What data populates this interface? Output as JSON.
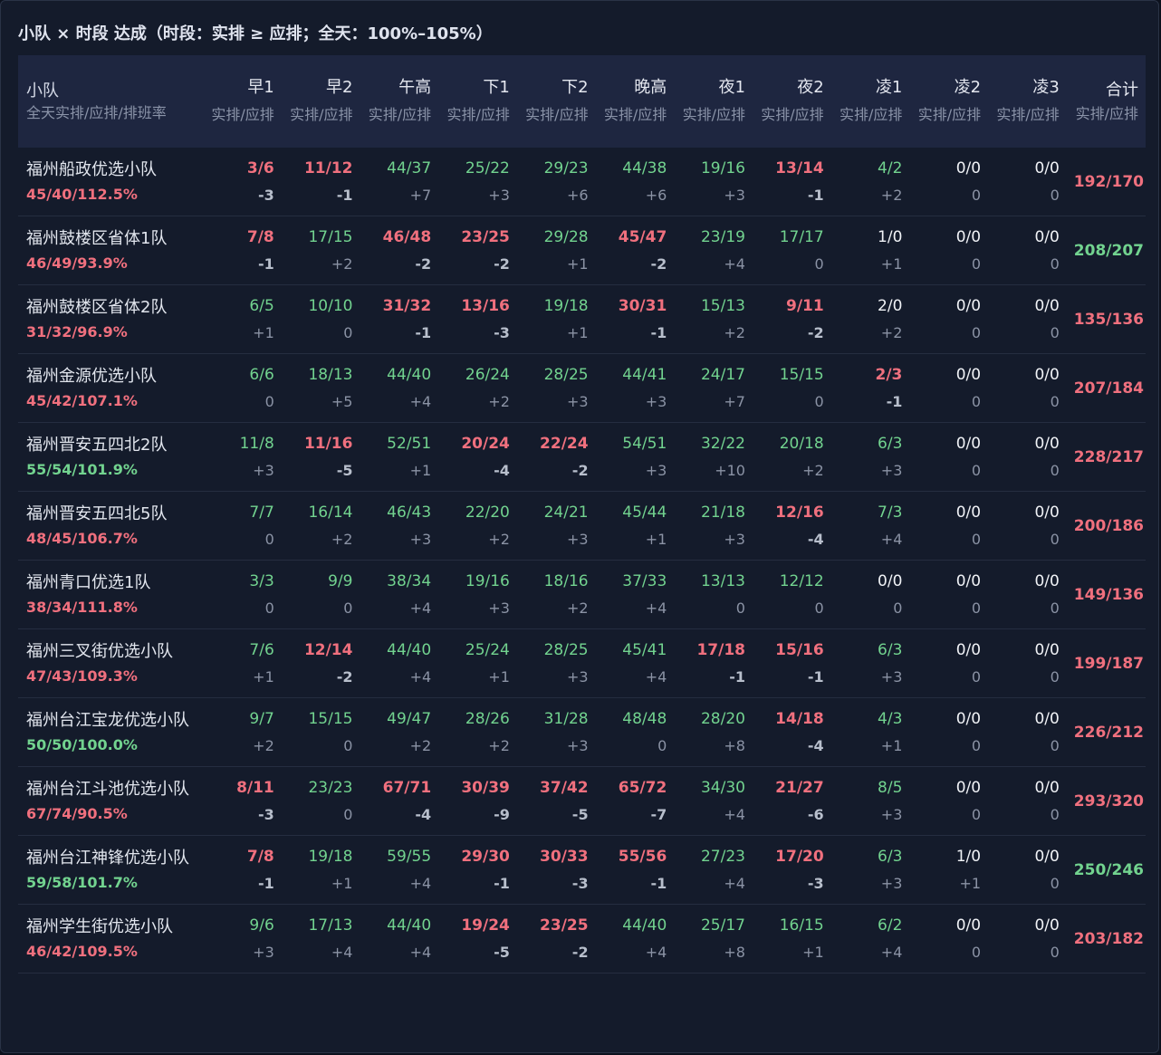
{
  "title": "小队 × 时段 达成（时段：实排 ≥ 应排；全天：100%–105%）",
  "colors": {
    "below": "#f0707e",
    "ok": "#72d38f",
    "zero": "#f0f2f6"
  },
  "header": {
    "team_title": "小队",
    "team_sub": "全天实排/应排/排班率",
    "slots": [
      {
        "name": "早1",
        "sub": "实排/应排"
      },
      {
        "name": "早2",
        "sub": "实排/应排"
      },
      {
        "name": "午高",
        "sub": "实排/应排"
      },
      {
        "name": "下1",
        "sub": "实排/应排"
      },
      {
        "name": "下2",
        "sub": "实排/应排"
      },
      {
        "name": "晚高",
        "sub": "实排/应排"
      },
      {
        "name": "夜1",
        "sub": "实排/应排"
      },
      {
        "name": "夜2",
        "sub": "实排/应排"
      },
      {
        "name": "凌1",
        "sub": "实排/应排"
      },
      {
        "name": "凌2",
        "sub": "实排/应排"
      },
      {
        "name": "凌3",
        "sub": "实排/应排"
      }
    ],
    "total_name": "合计",
    "total_sub": "实排/应排"
  },
  "rows": [
    {
      "team": "福州船政优选小队",
      "summary": "45/40/112.5%",
      "summary_status": "red",
      "cells": [
        [
          "3/6",
          "-3",
          "red"
        ],
        [
          "11/12",
          "-1",
          "red"
        ],
        [
          "44/37",
          "+7",
          "green"
        ],
        [
          "25/22",
          "+3",
          "green"
        ],
        [
          "29/23",
          "+6",
          "green"
        ],
        [
          "44/38",
          "+6",
          "green"
        ],
        [
          "19/16",
          "+3",
          "green"
        ],
        [
          "13/14",
          "-1",
          "red"
        ],
        [
          "4/2",
          "+2",
          "green"
        ],
        [
          "0/0",
          "0",
          "white"
        ],
        [
          "0/0",
          "0",
          "white"
        ]
      ],
      "total": "192/170",
      "total_status": "red"
    },
    {
      "team": "福州鼓楼区省体1队",
      "summary": "46/49/93.9%",
      "summary_status": "red",
      "cells": [
        [
          "7/8",
          "-1",
          "red"
        ],
        [
          "17/15",
          "+2",
          "green"
        ],
        [
          "46/48",
          "-2",
          "red"
        ],
        [
          "23/25",
          "-2",
          "red"
        ],
        [
          "29/28",
          "+1",
          "green"
        ],
        [
          "45/47",
          "-2",
          "red"
        ],
        [
          "23/19",
          "+4",
          "green"
        ],
        [
          "17/17",
          "0",
          "green"
        ],
        [
          "1/0",
          "+1",
          "white"
        ],
        [
          "0/0",
          "0",
          "white"
        ],
        [
          "0/0",
          "0",
          "white"
        ]
      ],
      "total": "208/207",
      "total_status": "green"
    },
    {
      "team": "福州鼓楼区省体2队",
      "summary": "31/32/96.9%",
      "summary_status": "red",
      "cells": [
        [
          "6/5",
          "+1",
          "green"
        ],
        [
          "10/10",
          "0",
          "green"
        ],
        [
          "31/32",
          "-1",
          "red"
        ],
        [
          "13/16",
          "-3",
          "red"
        ],
        [
          "19/18",
          "+1",
          "green"
        ],
        [
          "30/31",
          "-1",
          "red"
        ],
        [
          "15/13",
          "+2",
          "green"
        ],
        [
          "9/11",
          "-2",
          "red"
        ],
        [
          "2/0",
          "+2",
          "white"
        ],
        [
          "0/0",
          "0",
          "white"
        ],
        [
          "0/0",
          "0",
          "white"
        ]
      ],
      "total": "135/136",
      "total_status": "red"
    },
    {
      "team": "福州金源优选小队",
      "summary": "45/42/107.1%",
      "summary_status": "red",
      "cells": [
        [
          "6/6",
          "0",
          "green"
        ],
        [
          "18/13",
          "+5",
          "green"
        ],
        [
          "44/40",
          "+4",
          "green"
        ],
        [
          "26/24",
          "+2",
          "green"
        ],
        [
          "28/25",
          "+3",
          "green"
        ],
        [
          "44/41",
          "+3",
          "green"
        ],
        [
          "24/17",
          "+7",
          "green"
        ],
        [
          "15/15",
          "0",
          "green"
        ],
        [
          "2/3",
          "-1",
          "red"
        ],
        [
          "0/0",
          "0",
          "white"
        ],
        [
          "0/0",
          "0",
          "white"
        ]
      ],
      "total": "207/184",
      "total_status": "red"
    },
    {
      "team": "福州晋安五四北2队",
      "summary": "55/54/101.9%",
      "summary_status": "green",
      "cells": [
        [
          "11/8",
          "+3",
          "green"
        ],
        [
          "11/16",
          "-5",
          "red"
        ],
        [
          "52/51",
          "+1",
          "green"
        ],
        [
          "20/24",
          "-4",
          "red"
        ],
        [
          "22/24",
          "-2",
          "red"
        ],
        [
          "54/51",
          "+3",
          "green"
        ],
        [
          "32/22",
          "+10",
          "green"
        ],
        [
          "20/18",
          "+2",
          "green"
        ],
        [
          "6/3",
          "+3",
          "green"
        ],
        [
          "0/0",
          "0",
          "white"
        ],
        [
          "0/0",
          "0",
          "white"
        ]
      ],
      "total": "228/217",
      "total_status": "red"
    },
    {
      "team": "福州晋安五四北5队",
      "summary": "48/45/106.7%",
      "summary_status": "red",
      "cells": [
        [
          "7/7",
          "0",
          "green"
        ],
        [
          "16/14",
          "+2",
          "green"
        ],
        [
          "46/43",
          "+3",
          "green"
        ],
        [
          "22/20",
          "+2",
          "green"
        ],
        [
          "24/21",
          "+3",
          "green"
        ],
        [
          "45/44",
          "+1",
          "green"
        ],
        [
          "21/18",
          "+3",
          "green"
        ],
        [
          "12/16",
          "-4",
          "red"
        ],
        [
          "7/3",
          "+4",
          "green"
        ],
        [
          "0/0",
          "0",
          "white"
        ],
        [
          "0/0",
          "0",
          "white"
        ]
      ],
      "total": "200/186",
      "total_status": "red"
    },
    {
      "team": "福州青口优选1队",
      "summary": "38/34/111.8%",
      "summary_status": "red",
      "cells": [
        [
          "3/3",
          "0",
          "green"
        ],
        [
          "9/9",
          "0",
          "green"
        ],
        [
          "38/34",
          "+4",
          "green"
        ],
        [
          "19/16",
          "+3",
          "green"
        ],
        [
          "18/16",
          "+2",
          "green"
        ],
        [
          "37/33",
          "+4",
          "green"
        ],
        [
          "13/13",
          "0",
          "green"
        ],
        [
          "12/12",
          "0",
          "green"
        ],
        [
          "0/0",
          "0",
          "white"
        ],
        [
          "0/0",
          "0",
          "white"
        ],
        [
          "0/0",
          "0",
          "white"
        ]
      ],
      "total": "149/136",
      "total_status": "red"
    },
    {
      "team": "福州三叉街优选小队",
      "summary": "47/43/109.3%",
      "summary_status": "red",
      "cells": [
        [
          "7/6",
          "+1",
          "green"
        ],
        [
          "12/14",
          "-2",
          "red"
        ],
        [
          "44/40",
          "+4",
          "green"
        ],
        [
          "25/24",
          "+1",
          "green"
        ],
        [
          "28/25",
          "+3",
          "green"
        ],
        [
          "45/41",
          "+4",
          "green"
        ],
        [
          "17/18",
          "-1",
          "red"
        ],
        [
          "15/16",
          "-1",
          "red"
        ],
        [
          "6/3",
          "+3",
          "green"
        ],
        [
          "0/0",
          "0",
          "white"
        ],
        [
          "0/0",
          "0",
          "white"
        ]
      ],
      "total": "199/187",
      "total_status": "red"
    },
    {
      "team": "福州台江宝龙优选小队",
      "summary": "50/50/100.0%",
      "summary_status": "green",
      "cells": [
        [
          "9/7",
          "+2",
          "green"
        ],
        [
          "15/15",
          "0",
          "green"
        ],
        [
          "49/47",
          "+2",
          "green"
        ],
        [
          "28/26",
          "+2",
          "green"
        ],
        [
          "31/28",
          "+3",
          "green"
        ],
        [
          "48/48",
          "0",
          "green"
        ],
        [
          "28/20",
          "+8",
          "green"
        ],
        [
          "14/18",
          "-4",
          "red"
        ],
        [
          "4/3",
          "+1",
          "green"
        ],
        [
          "0/0",
          "0",
          "white"
        ],
        [
          "0/0",
          "0",
          "white"
        ]
      ],
      "total": "226/212",
      "total_status": "red"
    },
    {
      "team": "福州台江斗池优选小队",
      "summary": "67/74/90.5%",
      "summary_status": "red",
      "cells": [
        [
          "8/11",
          "-3",
          "red"
        ],
        [
          "23/23",
          "0",
          "green"
        ],
        [
          "67/71",
          "-4",
          "red"
        ],
        [
          "30/39",
          "-9",
          "red"
        ],
        [
          "37/42",
          "-5",
          "red"
        ],
        [
          "65/72",
          "-7",
          "red"
        ],
        [
          "34/30",
          "+4",
          "green"
        ],
        [
          "21/27",
          "-6",
          "red"
        ],
        [
          "8/5",
          "+3",
          "green"
        ],
        [
          "0/0",
          "0",
          "white"
        ],
        [
          "0/0",
          "0",
          "white"
        ]
      ],
      "total": "293/320",
      "total_status": "red"
    },
    {
      "team": "福州台江神锋优选小队",
      "summary": "59/58/101.7%",
      "summary_status": "green",
      "cells": [
        [
          "7/8",
          "-1",
          "red"
        ],
        [
          "19/18",
          "+1",
          "green"
        ],
        [
          "59/55",
          "+4",
          "green"
        ],
        [
          "29/30",
          "-1",
          "red"
        ],
        [
          "30/33",
          "-3",
          "red"
        ],
        [
          "55/56",
          "-1",
          "red"
        ],
        [
          "27/23",
          "+4",
          "green"
        ],
        [
          "17/20",
          "-3",
          "red"
        ],
        [
          "6/3",
          "+3",
          "green"
        ],
        [
          "1/0",
          "+1",
          "white"
        ],
        [
          "0/0",
          "0",
          "white"
        ]
      ],
      "total": "250/246",
      "total_status": "green"
    },
    {
      "team": "福州学生街优选小队",
      "summary": "46/42/109.5%",
      "summary_status": "red",
      "cells": [
        [
          "9/6",
          "+3",
          "green"
        ],
        [
          "17/13",
          "+4",
          "green"
        ],
        [
          "44/40",
          "+4",
          "green"
        ],
        [
          "19/24",
          "-5",
          "red"
        ],
        [
          "23/25",
          "-2",
          "red"
        ],
        [
          "44/40",
          "+4",
          "green"
        ],
        [
          "25/17",
          "+8",
          "green"
        ],
        [
          "16/15",
          "+1",
          "green"
        ],
        [
          "6/2",
          "+4",
          "green"
        ],
        [
          "0/0",
          "0",
          "white"
        ],
        [
          "0/0",
          "0",
          "white"
        ]
      ],
      "total": "203/182",
      "total_status": "red"
    }
  ]
}
